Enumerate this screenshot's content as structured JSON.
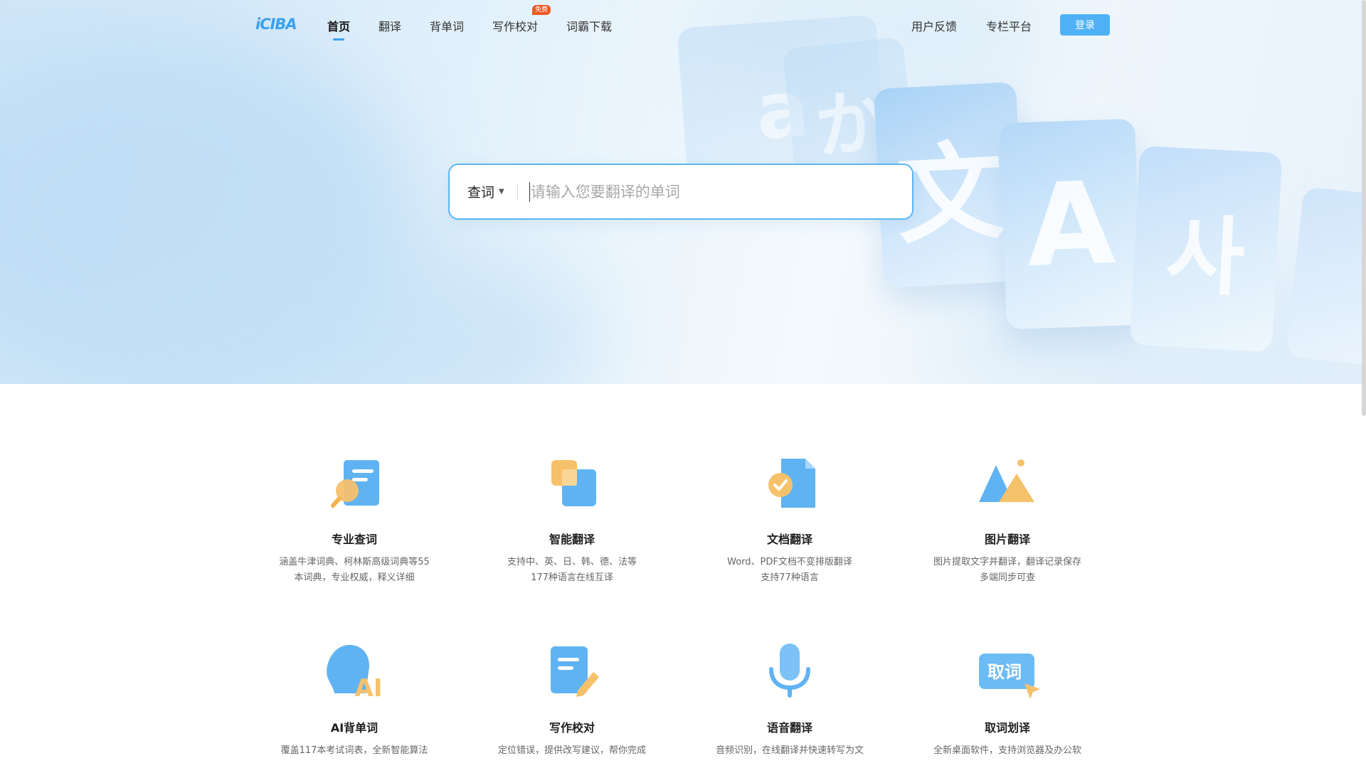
{
  "nav": {
    "logo": "iCIBA",
    "items": [
      "首页",
      "翻译",
      "背单词",
      "写作校对",
      "词霸下载"
    ],
    "badge": "免费",
    "right_items": [
      "用户反馈",
      "专栏平台"
    ],
    "login": "登录"
  },
  "hero": {
    "card_glyphs": [
      "a",
      "か",
      "文",
      "A",
      "사"
    ]
  },
  "search": {
    "mode": "查词",
    "placeholder": "请输入您要翻译的单词"
  },
  "features": [
    {
      "title": "专业查词",
      "desc": [
        "涵盖牛津词典、柯林斯高级词典等55",
        "本词典，专业权威，释义详细"
      ],
      "icon": "search-document-icon"
    },
    {
      "title": "智能翻译",
      "desc": [
        "支持中、英、日、韩、德、法等",
        "177种语言在线互译"
      ],
      "icon": "translate-squares-icon"
    },
    {
      "title": "文档翻译",
      "desc": [
        "Word、PDF文档不变排版翻译",
        "支持77种语言"
      ],
      "icon": "document-check-icon"
    },
    {
      "title": "图片翻译",
      "desc": [
        "图片提取文字并翻译，翻译记录保存",
        "多端同步可查"
      ],
      "icon": "image-mountain-icon"
    },
    {
      "title": "AI背单词",
      "desc": [
        "覆盖117本考试词表，全新智能算法",
        ""
      ],
      "icon": "ai-head-icon"
    },
    {
      "title": "写作校对",
      "desc": [
        "定位错误，提供改写建议，帮你完成",
        ""
      ],
      "icon": "edit-document-icon"
    },
    {
      "title": "语音翻译",
      "desc": [
        "音频识别，在线翻译并快速转写为文",
        ""
      ],
      "icon": "microphone-icon"
    },
    {
      "title": "取词划译",
      "desc": [
        "全新桌面软件，支持浏览器及办公软",
        ""
      ],
      "icon": "word-pick-icon"
    }
  ],
  "icon_text": {
    "ai": "AI",
    "quci": "取词"
  },
  "colors": {
    "accent": "#3aa0ee",
    "button": "#4eb1f6",
    "badge": "#ee5a24",
    "icon_blue": "#5fb3f3",
    "icon_orange": "#f6c16b"
  }
}
